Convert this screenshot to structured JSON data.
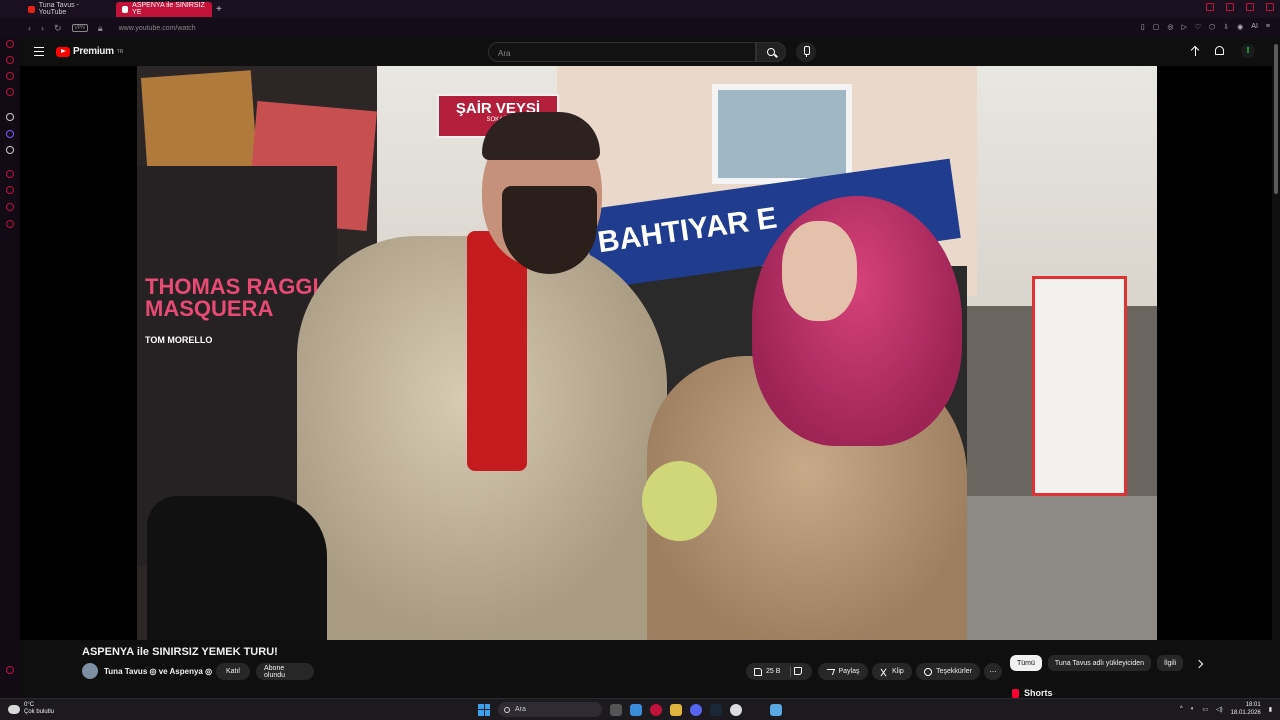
{
  "browser": {
    "tabs": [
      {
        "label": "Tuna Tavus - YouTube"
      },
      {
        "label": "ASPENYA ile SINIRSIZ YE"
      }
    ],
    "new_tab": "+",
    "vpn": "VPN",
    "url": "www.youtube.com/watch",
    "right_ai_label": "AI"
  },
  "header": {
    "logo_text": "Premium",
    "logo_region": "TR",
    "search_placeholder": "Ara"
  },
  "video_scene": {
    "sign_street": "ŞAİR VEYSİ",
    "sign_street_sub": "SOKAĞI",
    "sign_shop": "BAHTIYAR E",
    "poster_title": "THOMAS RAGGI MASQUERA",
    "poster_sub": "TOM MORELLO"
  },
  "video": {
    "title": "ASPENYA ile SINIRSIZ YEMEK TURU!",
    "channel": "Tuna Tavus ◎ ve Aspenya ◎",
    "join_label": "Katıl",
    "subscribed_label": "Abone olundu",
    "likes": "25 B",
    "share_label": "Paylaş",
    "clip_label": "Klip",
    "thanks_label": "Teşekkürler",
    "more": "⋯"
  },
  "chips": [
    "Tümü",
    "Tuna Tavus adlı yükleyiciden",
    "İlgili"
  ],
  "shorts_label": "Shorts",
  "taskbar": {
    "temp": "0°C",
    "weather": "Çok bulutlu",
    "search_placeholder": "Ara",
    "time": "18:01",
    "date": "18.01.2026"
  }
}
